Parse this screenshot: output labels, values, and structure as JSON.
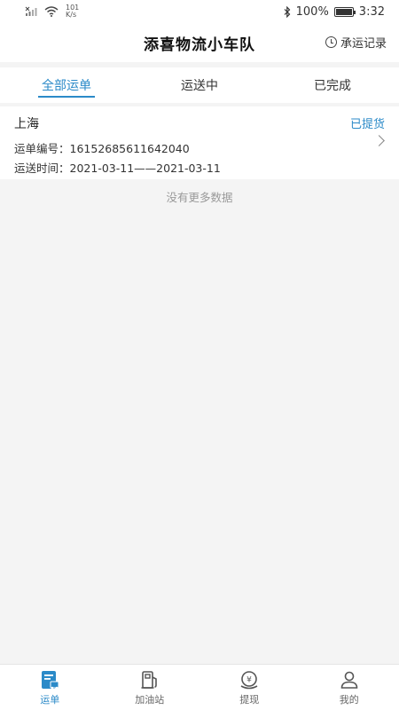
{
  "status_bar": {
    "speed_value": "101",
    "speed_unit": "K/s",
    "battery": "100%",
    "time": "3:32",
    "battery_level": 1.0
  },
  "header": {
    "title": "添喜物流小车队",
    "history_label": "承运记录"
  },
  "tabs": [
    {
      "label": "全部运单",
      "active": true
    },
    {
      "label": "运送中",
      "active": false
    },
    {
      "label": "已完成",
      "active": false
    }
  ],
  "orders": [
    {
      "city": "上海",
      "status": "已提货",
      "number_label": "运单编号：",
      "number": "16152685611642040",
      "time_label": "运送时间：",
      "time": "2021-03-11——2021-03-11"
    }
  ],
  "list_footer": "没有更多数据",
  "bottom_nav": [
    {
      "label": "运单",
      "icon": "waybill-icon",
      "active": true
    },
    {
      "label": "加油站",
      "icon": "gas-station-icon",
      "active": false
    },
    {
      "label": "提现",
      "icon": "withdraw-icon",
      "active": false
    },
    {
      "label": "我的",
      "icon": "user-icon",
      "active": false
    }
  ],
  "colors": {
    "accent": "#2b8ac8",
    "background": "#f4f4f4"
  }
}
